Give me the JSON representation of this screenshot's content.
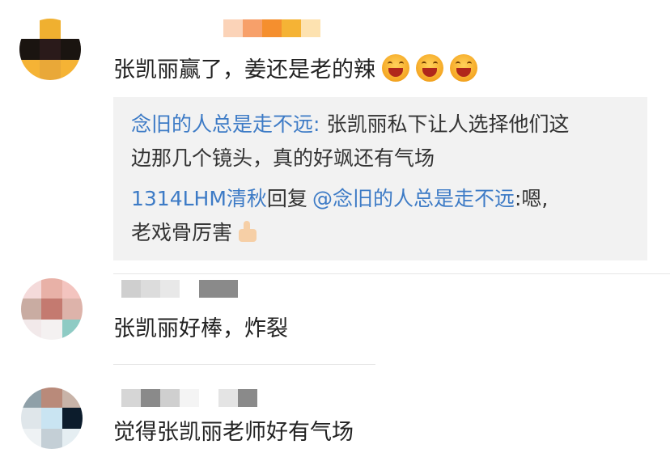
{
  "comments": [
    {
      "text": "张凯丽赢了，姜还是老的辣",
      "emojis": [
        "grinning-face-icon",
        "grinning-face-icon",
        "grinning-face-icon"
      ],
      "avatar_colors": [
        "#ffffff",
        "#f0b030",
        "#ffffff",
        "#1a1410",
        "#2a1a1a",
        "#1a1410",
        "#f5b335",
        "#e9a838",
        "#f5b335"
      ],
      "name_colors": [
        "#fbd3b8",
        "#f7a06a",
        "#f58f2e",
        "#f5b335",
        "#fde2b0"
      ]
    },
    {
      "text": "张凯丽好棒，炸裂",
      "avatar_colors": [
        "#f4dada",
        "#e8b1a7",
        "#f3c4bf",
        "#c9aca2",
        "#c47a70",
        "#ddb3aa",
        "#f2e9ea",
        "#f4f1f1",
        "#8ecbc4"
      ],
      "name_colors": [
        "#cfcfcf",
        "#dcdcdc",
        "#e8e8e8",
        "#ffffff",
        "#8a8a8a",
        "#8a8a8a"
      ]
    },
    {
      "text": "觉得张凯丽老师好有气场",
      "avatar_colors": [
        "#8fa0a8",
        "#b98a7a",
        "#c8b3a8",
        "#dfe6ea",
        "#c9e4f2",
        "#0c1c2c",
        "#eef2f4",
        "#c4cfd6",
        "#e5eef2"
      ],
      "name_colors": [
        "#d6d6d6",
        "#8a8a8a",
        "#cfcfcf",
        "#f4f4f4",
        "#ffffff",
        "#e4e4e4",
        "#8a8a8a"
      ]
    }
  ],
  "reply_box": {
    "reply1": {
      "user": "念旧的人总是走不远:",
      "line1_rest": "张凯丽私下让人选择他们这",
      "line2": "边那几个镜头，真的好飒还有气场"
    },
    "reply2": {
      "user": "1314LHM清秋",
      "verb": "回复",
      "mention": "@念旧的人总是走不远",
      "line1_rest": ":嗯,",
      "line2": "老戏骨厉害",
      "emoji": "thumbs-up-icon"
    }
  },
  "colors": {
    "link_blue": "#3d7bc6",
    "reply_bg": "#f2f2f2",
    "text": "#222222"
  }
}
